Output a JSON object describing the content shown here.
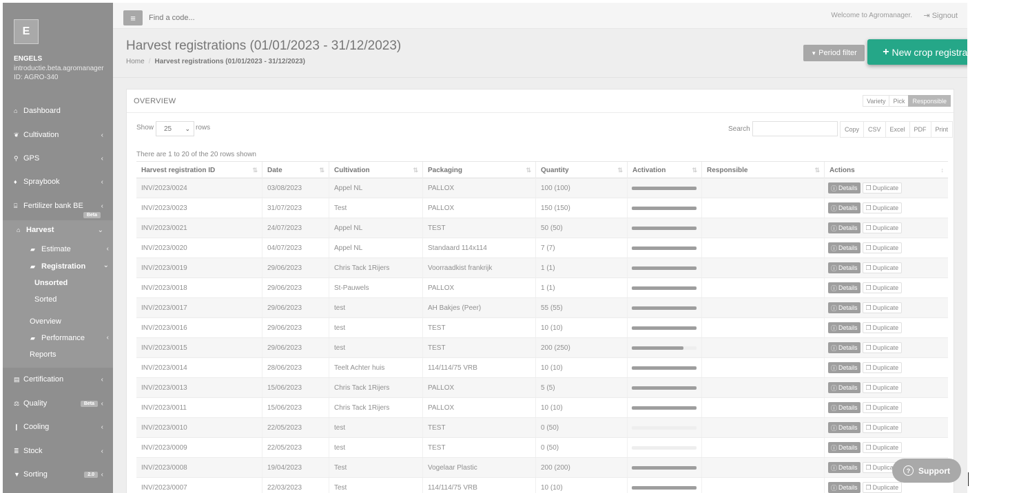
{
  "sidebar": {
    "avatar_letter": "E",
    "company_name": "ENGELS",
    "company_domain": "introductie.beta.agromanager",
    "company_id": "ID: AGRO-340",
    "items": [
      {
        "label": "Dashboard",
        "icon": "home-icon"
      },
      {
        "label": "Cultivation",
        "icon": "leaf-icon"
      },
      {
        "label": "GPS",
        "icon": "map-marker-icon"
      },
      {
        "label": "Spraybook",
        "icon": "tint-icon"
      },
      {
        "label": "Fertilizer bank BE",
        "icon": "bank-icon",
        "badge": "Beta"
      },
      {
        "label": "Harvest",
        "icon": "basket-icon"
      },
      {
        "label": "Certification",
        "icon": "book-icon"
      },
      {
        "label": "Quality",
        "icon": "scale-icon",
        "badge": "Beta"
      },
      {
        "label": "Cooling",
        "icon": "thermometer-icon"
      },
      {
        "label": "Stock",
        "icon": "list-icon"
      },
      {
        "label": "Sorting",
        "icon": "filter-icon",
        "badge": "2.0"
      }
    ],
    "harvest_sub": {
      "estimate": "Estimate",
      "registration": "Registration",
      "unsorted": "Unsorted",
      "sorted": "Sorted",
      "overview": "Overview",
      "performance": "Performance",
      "reports": "Reports"
    }
  },
  "topbar": {
    "search_placeholder": "Find a code...",
    "welcome": "Welcome to Agromanager.",
    "signout": "Signout"
  },
  "header": {
    "title": "Harvest registrations (01/01/2023 - 31/12/2023)",
    "breadcrumb_home": "Home",
    "breadcrumb_current": "Harvest registrations (01/01/2023 - 31/12/2023)",
    "period_filter": "Period filter",
    "new_crop": "New crop registration"
  },
  "panel": {
    "title": "OVERVIEW",
    "view_toggle": [
      "Variety",
      "Pick",
      "Responsible"
    ],
    "active_view": "Responsible",
    "show": "Show",
    "page_size": "25",
    "rows": "rows",
    "search": "Search",
    "exports": [
      "Copy",
      "CSV",
      "Excel",
      "PDF",
      "Print"
    ],
    "info": "There are 1 to 20 of the 20 rows shown"
  },
  "table": {
    "columns": [
      "Harvest registration ID",
      "Date",
      "Cultivation",
      "Packaging",
      "Quantity",
      "Activation",
      "Responsible",
      "Actions"
    ],
    "details_label": "Details",
    "duplicate_label": "Duplicate",
    "rows": [
      {
        "id": "INV/2023/0024",
        "date": "03/08/2023",
        "cultivation": "Appel NL",
        "packaging": "PALLOX",
        "quantity": "100 (100)",
        "activation": 1.0
      },
      {
        "id": "INV/2023/0023",
        "date": "31/07/2023",
        "cultivation": "Test",
        "packaging": "PALLOX",
        "quantity": "150 (150)",
        "activation": 1.0
      },
      {
        "id": "INV/2023/0021",
        "date": "24/07/2023",
        "cultivation": "Appel NL",
        "packaging": "TEST",
        "quantity": "50 (50)",
        "activation": 1.0
      },
      {
        "id": "INV/2023/0020",
        "date": "04/07/2023",
        "cultivation": "Appel NL",
        "packaging": "Standaard 114x114",
        "quantity": "7 (7)",
        "activation": 1.0
      },
      {
        "id": "INV/2023/0019",
        "date": "29/06/2023",
        "cultivation": "Chris Tack 1Rijers",
        "packaging": "Voorraadkist frankrijk",
        "quantity": "1 (1)",
        "activation": 1.0
      },
      {
        "id": "INV/2023/0018",
        "date": "29/06/2023",
        "cultivation": "St-Pauwels",
        "packaging": "PALLOX",
        "quantity": "1 (1)",
        "activation": 1.0
      },
      {
        "id": "INV/2023/0017",
        "date": "29/06/2023",
        "cultivation": "test",
        "packaging": "AH Bakjes (Peer)",
        "quantity": "55 (55)",
        "activation": 1.0
      },
      {
        "id": "INV/2023/0016",
        "date": "29/06/2023",
        "cultivation": "test",
        "packaging": "TEST",
        "quantity": "10 (10)",
        "activation": 1.0
      },
      {
        "id": "INV/2023/0015",
        "date": "29/06/2023",
        "cultivation": "test",
        "packaging": "TEST",
        "quantity": "200 (250)",
        "activation": 0.8
      },
      {
        "id": "INV/2023/0014",
        "date": "28/06/2023",
        "cultivation": "Teelt Achter huis",
        "packaging": "114/114/75 VRB",
        "quantity": "10 (10)",
        "activation": 1.0
      },
      {
        "id": "INV/2023/0013",
        "date": "15/06/2023",
        "cultivation": "Chris Tack 1Rijers",
        "packaging": "PALLOX",
        "quantity": "5 (5)",
        "activation": 1.0
      },
      {
        "id": "INV/2023/0011",
        "date": "15/06/2023",
        "cultivation": "Chris Tack 1Rijers",
        "packaging": "PALLOX",
        "quantity": "10 (10)",
        "activation": 1.0
      },
      {
        "id": "INV/2023/0010",
        "date": "22/05/2023",
        "cultivation": "test",
        "packaging": "TEST",
        "quantity": "0 (50)",
        "activation": 0.0
      },
      {
        "id": "INV/2023/0009",
        "date": "22/05/2023",
        "cultivation": "test",
        "packaging": "TEST",
        "quantity": "0 (50)",
        "activation": 0.0
      },
      {
        "id": "INV/2023/0008",
        "date": "19/04/2023",
        "cultivation": "Test",
        "packaging": "Vogelaar Plastic",
        "quantity": "200 (200)",
        "activation": 1.0
      },
      {
        "id": "INV/2023/0007",
        "date": "22/03/2023",
        "cultivation": "Test",
        "packaging": "114/114/75 VRB",
        "quantity": "10 (10)",
        "activation": 1.0
      }
    ]
  },
  "support": {
    "label": "Support"
  }
}
